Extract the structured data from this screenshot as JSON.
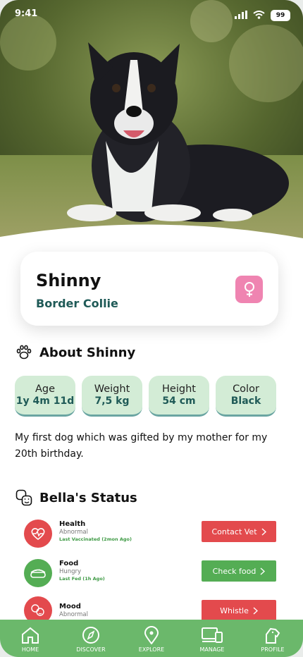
{
  "status_bar": {
    "time": "9:41",
    "battery": "99"
  },
  "pet": {
    "name": "Shinny",
    "breed": "Border Collie",
    "gender_icon": "female-symbol-icon"
  },
  "about": {
    "title": "About Shinny",
    "attributes": [
      {
        "label": "Age",
        "value": "1y 4m 11d"
      },
      {
        "label": "Weight",
        "value": "7,5 kg"
      },
      {
        "label": "Height",
        "value": "54 cm"
      },
      {
        "label": "Color",
        "value": "Black"
      }
    ],
    "description": "My first dog which was gifted by my mother for my 20th birthday."
  },
  "status": {
    "title": "Bella's Status",
    "items": [
      {
        "title": "Health",
        "subtitle": "Abnormal",
        "note": "Last Vaccinated (2mon Ago)",
        "button": "Contact Vet",
        "icon": "heart-pulse-icon"
      },
      {
        "title": "Food",
        "subtitle": "Hungry",
        "note": "Last Fed (1h Ago)",
        "button": "Check food",
        "icon": "food-bowl-icon"
      },
      {
        "title": "Mood",
        "subtitle": "Abnormal",
        "note": "",
        "button": "Whistle",
        "icon": "mood-faces-icon"
      }
    ]
  },
  "nav": [
    {
      "label": "HOME",
      "icon": "home-icon"
    },
    {
      "label": "DISCOVER",
      "icon": "compass-icon"
    },
    {
      "label": "EXPLORE",
      "icon": "map-pin-icon"
    },
    {
      "label": "MANAGE",
      "icon": "devices-icon"
    },
    {
      "label": "PROFILE",
      "icon": "profile-icon"
    }
  ],
  "colors": {
    "accent_green": "#6bb86b",
    "dark_teal": "#1f5a57",
    "attribute_bg": "#d3ecd6",
    "alert_red": "#e34a4d",
    "action_green": "#54ad54",
    "gender_pink": "#ef84b1"
  }
}
